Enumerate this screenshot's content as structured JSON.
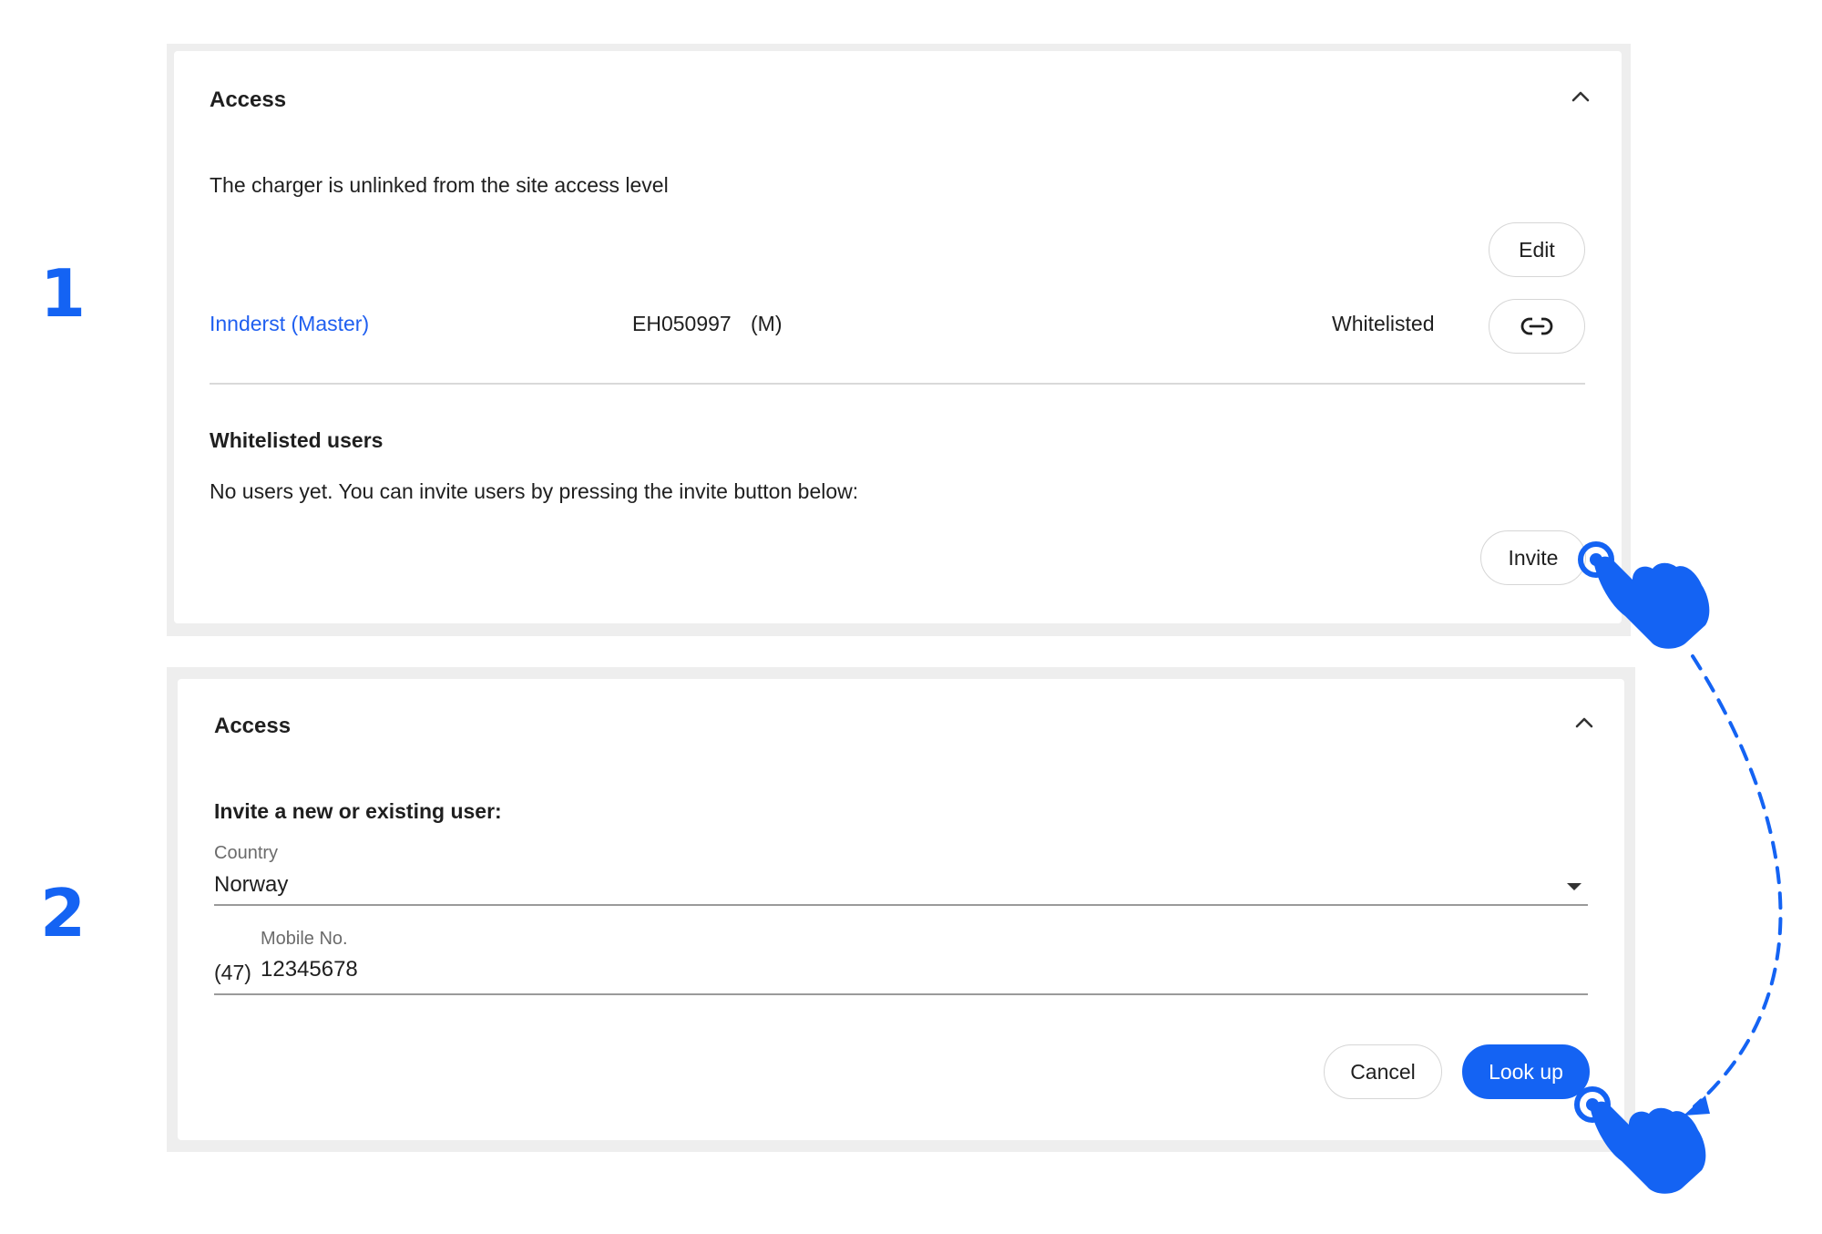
{
  "steps": [
    "1",
    "2"
  ],
  "panel1": {
    "title": "Access",
    "description": "The charger is unlinked from the site access level",
    "edit_label": "Edit",
    "site_name": "Innderst (Master)",
    "charger_id": "EH050997",
    "charger_role": "(M)",
    "access_status": "Whitelisted",
    "whitelist_heading": "Whitelisted users",
    "whitelist_empty": "No users yet. You can invite users by pressing the invite button below:",
    "invite_label": "Invite"
  },
  "panel2": {
    "title": "Access",
    "form_heading": "Invite a new or existing user:",
    "country_label": "Country",
    "country_value": "Norway",
    "mobile_label": "Mobile No.",
    "mobile_prefix": "(47)",
    "mobile_value": "12345678",
    "cancel_label": "Cancel",
    "lookup_label": "Look up"
  },
  "colors": {
    "accent": "#1463f3",
    "link": "#1f5ff0",
    "frame": "#eeeeee"
  },
  "icons": {
    "collapse": "chevron-up-icon",
    "link": "link-icon",
    "dropdown": "caret-down-icon",
    "pointer": "hand-pointer-icon"
  }
}
